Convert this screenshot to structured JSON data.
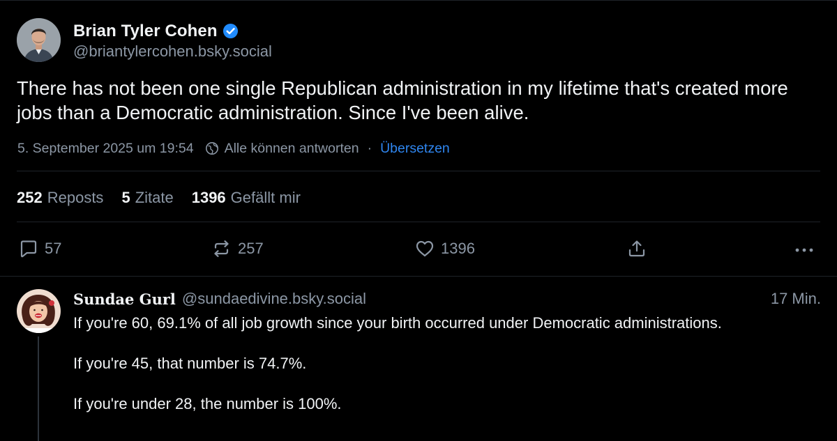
{
  "post": {
    "author_name": "Brian Tyler Cohen",
    "author_handle": "@briantylercohen.bsky.social",
    "verified": true,
    "text": "There has not been one single Republican administration in my lifetime that's created more jobs than a Democratic administration. Since I've been alive.",
    "timestamp": "5. September 2025 um 19:54",
    "reply_setting": "Alle können antworten",
    "separator": "·",
    "translate_label": "Übersetzen",
    "stats": [
      {
        "count": "252",
        "label": "Reposts"
      },
      {
        "count": "5",
        "label": "Zitate"
      },
      {
        "count": "1396",
        "label": "Gefällt mir"
      }
    ],
    "actions": {
      "reply_count": "57",
      "repost_count": "257",
      "like_count": "1396"
    }
  },
  "reply": {
    "author_name": "Sundae Gurl",
    "author_handle": "@sundaedivine.bsky.social",
    "time": "17 Min.",
    "paragraphs": [
      "If you're 60, 69.1% of all job growth since your birth occurred under Democratic administrations.",
      "If you're 45, that number is 74.7%.",
      "If you're under 28, the number is 100%."
    ]
  },
  "colors": {
    "background": "#000000",
    "text_primary": "#f1f3f5",
    "text_secondary": "#8c97a5",
    "link": "#2f86f0",
    "verified_badge": "#208bfe",
    "divider": "#1e2329"
  },
  "icons": [
    "verified-badge-icon",
    "globe-reply-setting-icon",
    "reply-bubble-icon",
    "repost-icon",
    "heart-icon",
    "share-icon",
    "more-options-icon"
  ]
}
